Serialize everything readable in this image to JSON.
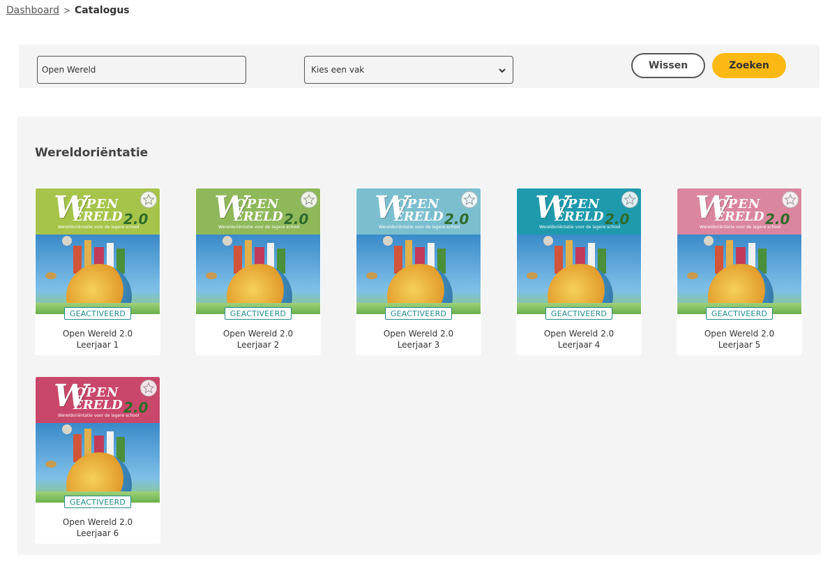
{
  "breadcrumb": {
    "home": "Dashboard",
    "separator": ">",
    "current": "Catalogus"
  },
  "search": {
    "query_value": "Open Wereld",
    "subject_selected": "Kies een vak",
    "clear_label": "Wissen",
    "search_label": "Zoeken"
  },
  "colors": {
    "accent": "#fdb913",
    "badge": "#1f8c8a"
  },
  "section": {
    "title": "Wereldoriëntatie"
  },
  "products": [
    {
      "name": "Open Wereld 2.0",
      "grade": "Leerjaar 1",
      "status": "GEACTIVEERD",
      "cover_color": "#a6c44a",
      "favorite_icon": "star-outline-icon"
    },
    {
      "name": "Open Wereld 2.0",
      "grade": "Leerjaar 2",
      "status": "GEACTIVEERD",
      "cover_color": "#8fb85a",
      "favorite_icon": "star-outline-icon"
    },
    {
      "name": "Open Wereld 2.0",
      "grade": "Leerjaar 3",
      "status": "GEACTIVEERD",
      "cover_color": "#7bbfcf",
      "favorite_icon": "star-outline-icon"
    },
    {
      "name": "Open Wereld 2.0",
      "grade": "Leerjaar 4",
      "status": "GEACTIVEERD",
      "cover_color": "#1f9aad",
      "favorite_icon": "star-outline-icon"
    },
    {
      "name": "Open Wereld 2.0",
      "grade": "Leerjaar 5",
      "status": "GEACTIVEERD",
      "cover_color": "#d9869e",
      "favorite_icon": "star-outline-icon"
    },
    {
      "name": "Open Wereld 2.0",
      "grade": "Leerjaar 6",
      "status": "GEACTIVEERD",
      "cover_color": "#c8476a",
      "favorite_icon": "star-outline-icon"
    }
  ],
  "cover_art": {
    "logo_letter": "W",
    "logo_open": "OPEN",
    "logo_wereld": "ERELD",
    "logo_version": "2.0",
    "subtitle": "Wereldoriëntatie voor de lagere school"
  }
}
